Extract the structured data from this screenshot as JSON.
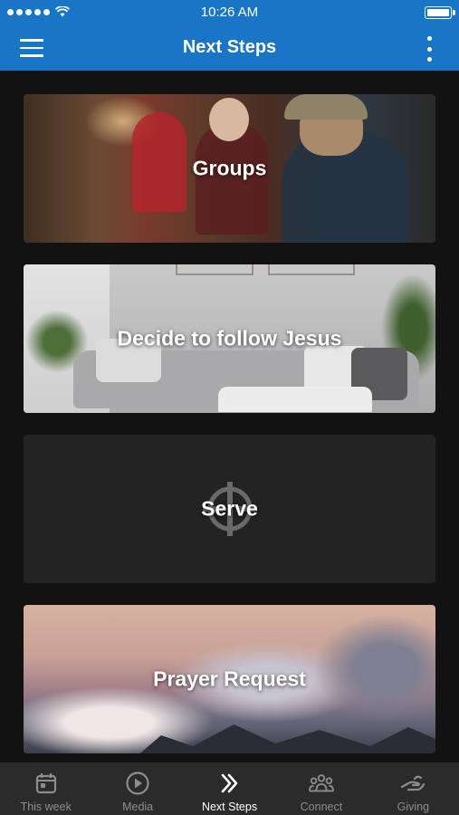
{
  "status_bar": {
    "time": "10:26 AM"
  },
  "app_bar": {
    "title": "Next Steps"
  },
  "cards": [
    {
      "title": "Groups"
    },
    {
      "title": "Decide to follow Jesus"
    },
    {
      "title": "Serve"
    },
    {
      "title": "Prayer Request"
    }
  ],
  "bottom_nav": {
    "items": [
      {
        "label": "This week",
        "icon": "calendar-icon",
        "active": false
      },
      {
        "label": "Media",
        "icon": "play-circle-icon",
        "active": false
      },
      {
        "label": "Next Steps",
        "icon": "double-chevron-right-icon",
        "active": true
      },
      {
        "label": "Connect",
        "icon": "people-icon",
        "active": false
      },
      {
        "label": "Giving",
        "icon": "giving-hand-icon",
        "active": false
      }
    ]
  },
  "colors": {
    "primary": "#1976c6",
    "background": "#121212",
    "nav_background": "#2b2b2b",
    "nav_inactive": "#8d8d8d",
    "nav_active": "#ffffff"
  }
}
